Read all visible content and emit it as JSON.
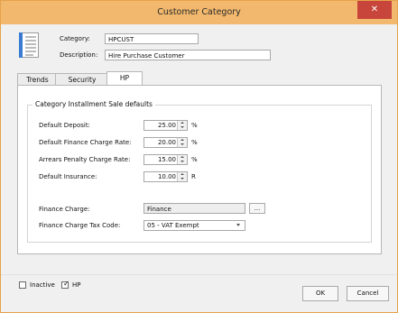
{
  "window": {
    "title": "Customer Category",
    "close_glyph": "✕"
  },
  "header": {
    "category_label": "Category:",
    "category_value": "HPCUST",
    "description_label": "Description:",
    "description_value": "Hire Purchase Customer"
  },
  "tabs": [
    {
      "label": "Trends"
    },
    {
      "label": "Security"
    },
    {
      "label": "HP"
    }
  ],
  "hp": {
    "group_title": "Category Installment Sale defaults",
    "fields": [
      {
        "label": "Default Deposit:",
        "value": "25.00",
        "unit": "%"
      },
      {
        "label": "Default Finance Charge Rate:",
        "value": "20.00",
        "unit": "%"
      },
      {
        "label": "Arrears Penalty Charge Rate:",
        "value": "15.00",
        "unit": "%"
      },
      {
        "label": "Default Insurance:",
        "value": "10.00",
        "unit": "R"
      }
    ],
    "finance_charge_label": "Finance Charge:",
    "finance_charge_value": "Finance",
    "browse_label": "...",
    "tax_code_label": "Finance Charge Tax Code:",
    "tax_code_value": "05 - VAT Exempt"
  },
  "footer": {
    "inactive_label": "Inactive",
    "inactive_checked": false,
    "hp_label": "HP",
    "hp_checked": true,
    "ok_label": "OK",
    "cancel_label": "Cancel"
  },
  "colors": {
    "titlebar": "#f2b86d",
    "close": "#c7453a",
    "window_bg": "#f0f0f0",
    "panel_bg": "#ffffff"
  },
  "icons": {
    "form": "form-icon",
    "close": "close-icon",
    "spin_up": "arrow-up-icon",
    "spin_down": "arrow-down-icon",
    "dropdown": "chevron-down-icon",
    "check": "checkmark-icon"
  }
}
